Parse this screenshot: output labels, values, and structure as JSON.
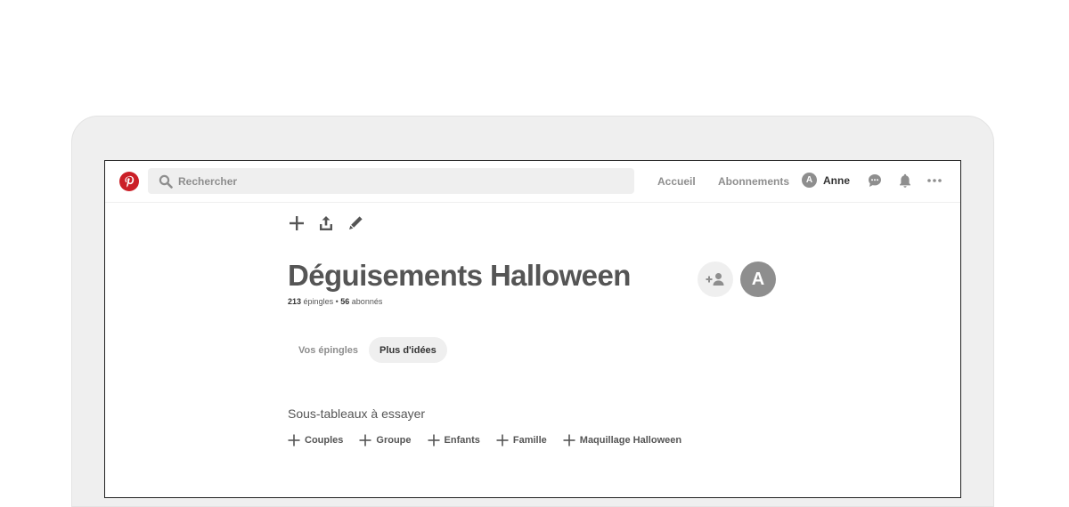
{
  "header": {
    "search": {
      "placeholder": "Rechercher"
    },
    "nav": {
      "home": "Accueil",
      "following": "Abonnements",
      "user": {
        "initial": "A",
        "name": "Anne"
      }
    },
    "icons": [
      "pinterest-logo-icon",
      "search-icon",
      "chat-icon",
      "bell-icon",
      "more-icon"
    ]
  },
  "board": {
    "tools": [
      "plus-icon",
      "share-icon",
      "edit-icon"
    ],
    "title": "Déguisements Halloween",
    "stats": {
      "pins_count": "213",
      "pins_label": "épingles",
      "separator": "•",
      "followers_count": "56",
      "followers_label": "abonnés"
    },
    "collaborator": {
      "initial": "A"
    }
  },
  "tabs": [
    {
      "label": "Vos épingles",
      "active": false
    },
    {
      "label": "Plus d'idées",
      "active": true
    }
  ],
  "subboards": {
    "title": "Sous-tableaux à essayer",
    "items": [
      {
        "label": "Couples"
      },
      {
        "label": "Groupe"
      },
      {
        "label": "Enfants"
      },
      {
        "label": "Famille"
      },
      {
        "label": "Maquillage Halloween"
      }
    ]
  },
  "colors": {
    "brand": "#cb1f27",
    "text_primary": "#333333",
    "text_secondary": "#8e8e8e",
    "surface": "#efefef"
  }
}
